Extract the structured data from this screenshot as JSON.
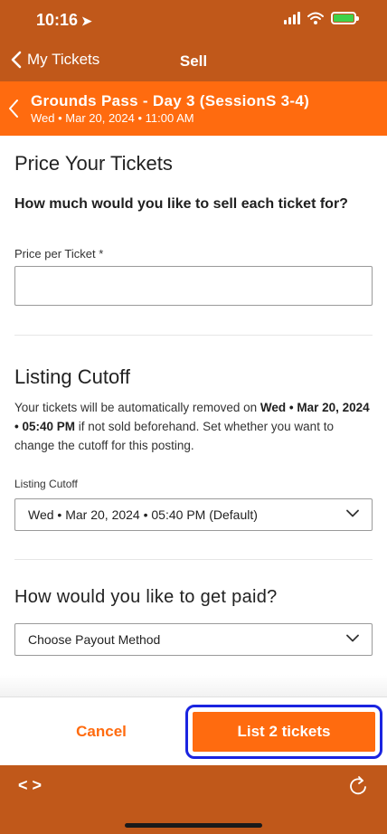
{
  "status_bar": {
    "time": "10:16"
  },
  "nav": {
    "back_label": "My Tickets",
    "title": "Sell"
  },
  "event": {
    "title": "Grounds Pass - Day 3 (SessionS 3-4)",
    "date": "Wed • Mar 20, 2024 • 11:00 AM"
  },
  "price_section": {
    "title": "Price Your Tickets",
    "question": "How much would you like to sell each ticket for?",
    "field_label": "Price per Ticket *",
    "field_value": ""
  },
  "cutoff_section": {
    "title": "Listing Cutoff",
    "text_before": "Your tickets will be automatically removed on ",
    "cutoff_date": "Wed • Mar 20, 2024 • 05:40 PM",
    "text_after": " if not sold beforehand. Set whether you want to change the cutoff for this posting.",
    "field_label": "Listing Cutoff",
    "selected_value": "Wed • Mar 20, 2024 • 05:40 PM (Default)"
  },
  "payout_section": {
    "title": "How would you like to get paid?",
    "selected_value": "Choose Payout Method"
  },
  "actions": {
    "cancel_label": "Cancel",
    "list_label": "List 2 tickets"
  },
  "browser": {
    "code_symbol": "< >"
  },
  "colors": {
    "brand_dark": "#c0581a",
    "brand": "#ff6b0f",
    "highlight": "#1a24e0",
    "battery": "#3fd24a"
  }
}
